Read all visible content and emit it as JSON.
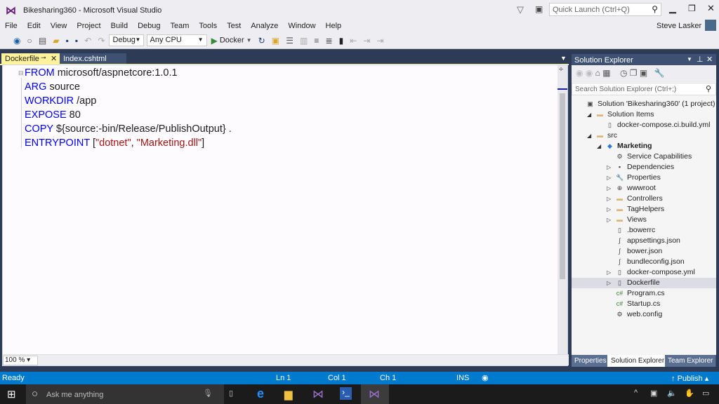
{
  "window": {
    "title": "Bikesharing360 - Microsoft Visual Studio",
    "quick_launch_placeholder": "Quick Launch (Ctrl+Q)",
    "user": "Steve Lasker"
  },
  "menu": [
    "File",
    "Edit",
    "View",
    "Project",
    "Build",
    "Debug",
    "Team",
    "Tools",
    "Test",
    "Analyze",
    "Window",
    "Help"
  ],
  "toolbar": {
    "configuration": "Debug",
    "platform": "Any CPU",
    "run_target": "Docker"
  },
  "editor": {
    "tabs": [
      {
        "label": "Dockerfile",
        "active": true
      },
      {
        "label": "Index.cshtml",
        "active": false
      }
    ],
    "lines": [
      {
        "kw": "FROM",
        "rest": " microsoft/aspnetcore:1.0.1"
      },
      {
        "kw": "ARG",
        "rest": " source"
      },
      {
        "kw": "WORKDIR",
        "rest": " /app"
      },
      {
        "kw": "EXPOSE",
        "rest": " 80"
      },
      {
        "kw": "COPY",
        "rest": " ${source:-bin/Release/PublishOutput} ."
      },
      {
        "kw": "ENTRYPOINT",
        "rest": " [",
        "s1": "\"dotnet\"",
        "mid": ", ",
        "s2": "\"Marketing.dll\"",
        "end": "]"
      }
    ],
    "zoom": "100 %"
  },
  "solution_explorer": {
    "title": "Solution Explorer",
    "search_placeholder": "Search Solution Explorer (Ctrl+;)",
    "items": [
      {
        "label": "Solution 'Bikesharing360' (1 project)",
        "icon": "solution-icon",
        "expander": ""
      },
      {
        "label": "Solution Items",
        "icon": "folder-icon",
        "expander": "◢"
      },
      {
        "label": "docker-compose.ci.build.yml",
        "icon": "file-icon",
        "expander": ""
      },
      {
        "label": "src",
        "icon": "folder-icon",
        "expander": "◢"
      },
      {
        "label": "Marketing",
        "icon": "project-icon",
        "expander": "◢"
      },
      {
        "label": "Service Capabilities",
        "icon": "service-icon",
        "expander": ""
      },
      {
        "label": "Dependencies",
        "icon": "dependencies-icon",
        "expander": "▷"
      },
      {
        "label": "Properties",
        "icon": "wrench-icon",
        "expander": "▷"
      },
      {
        "label": "wwwroot",
        "icon": "globe-icon",
        "expander": "▷"
      },
      {
        "label": "Controllers",
        "icon": "folder-icon",
        "expander": "▷"
      },
      {
        "label": "TagHelpers",
        "icon": "folder-icon",
        "expander": "▷"
      },
      {
        "label": "Views",
        "icon": "folder-icon",
        "expander": "▷"
      },
      {
        "label": ".bowerrc",
        "icon": "file-icon",
        "expander": ""
      },
      {
        "label": "appsettings.json",
        "icon": "json-icon",
        "expander": ""
      },
      {
        "label": "bower.json",
        "icon": "json-icon",
        "expander": ""
      },
      {
        "label": "bundleconfig.json",
        "icon": "json-icon",
        "expander": ""
      },
      {
        "label": "docker-compose.yml",
        "icon": "file-icon",
        "expander": "▷"
      },
      {
        "label": "Dockerfile",
        "icon": "file-icon",
        "expander": "▷"
      },
      {
        "label": "Program.cs",
        "icon": "csharp-icon",
        "expander": ""
      },
      {
        "label": "Startup.cs",
        "icon": "csharp-icon",
        "expander": ""
      },
      {
        "label": "web.config",
        "icon": "config-icon",
        "expander": ""
      }
    ],
    "bottom_tabs": [
      "Properties",
      "Solution Explorer",
      "Team Explorer"
    ]
  },
  "status": {
    "ready": "Ready",
    "ln": "Ln 1",
    "col": "Col 1",
    "ch": "Ch 1",
    "mode": "INS",
    "publish": "Publish"
  },
  "taskbar": {
    "search_placeholder": "Ask me anything"
  }
}
